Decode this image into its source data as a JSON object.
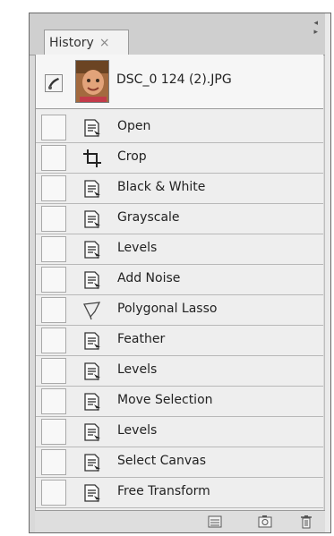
{
  "panel": {
    "tab_label": "History",
    "tab_close": "×",
    "snapshot_name": "DSC_0 124 (2).JPG"
  },
  "history_items": [
    {
      "label": "Open",
      "icon": "document-icon"
    },
    {
      "label": "Crop",
      "icon": "crop-icon"
    },
    {
      "label": "Black & White",
      "icon": "document-icon"
    },
    {
      "label": "Grayscale",
      "icon": "document-icon"
    },
    {
      "label": "Levels",
      "icon": "document-icon"
    },
    {
      "label": "Add Noise",
      "icon": "document-icon"
    },
    {
      "label": "Polygonal Lasso",
      "icon": "polygonal-lasso-icon"
    },
    {
      "label": "Feather",
      "icon": "document-icon"
    },
    {
      "label": "Levels",
      "icon": "document-icon"
    },
    {
      "label": "Move Selection",
      "icon": "document-icon"
    },
    {
      "label": "Levels",
      "icon": "document-icon"
    },
    {
      "label": "Select Canvas",
      "icon": "document-icon"
    },
    {
      "label": "Free Transform",
      "icon": "document-icon"
    }
  ],
  "footer_buttons": [
    "new-document-from-state-icon",
    "new-snapshot-icon",
    "trash-icon"
  ]
}
